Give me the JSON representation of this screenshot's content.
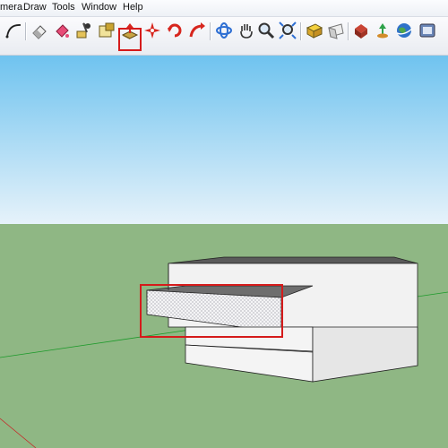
{
  "menu": {
    "camera": "mera",
    "draw": "Draw",
    "tools": "Tools",
    "window": "Window",
    "help": "Help"
  },
  "toolbar": {
    "tools": [
      "arc-icon",
      "eraser-icon",
      "paint-bucket-icon",
      "move-icon",
      "push-pull-icon",
      "scale-icon",
      "rotate-icon",
      "follow-me-icon",
      "orbit-icon",
      "pan-icon",
      "zoom-icon",
      "zoom-extents-icon",
      "components-icon",
      "3d-warehouse-icon",
      "google-earth-icon"
    ],
    "highlighted_tool": "push-pull-icon",
    "highlight_color": "#d51b1b"
  },
  "scene": {
    "sky_color": "#bfe0f2",
    "ground_color": "#8fb784"
  }
}
